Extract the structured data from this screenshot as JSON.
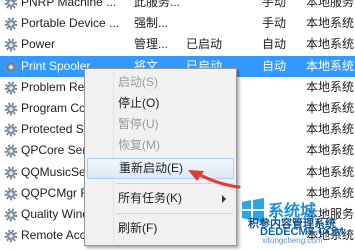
{
  "services": [
    {
      "name": "PNRP Machine ...",
      "desc": "此服务...",
      "status": "",
      "startup": "手动",
      "logon": "本地服务"
    },
    {
      "name": "Portable Device ...",
      "desc": "强制...",
      "status": "",
      "startup": "手动",
      "logon": "本地系统"
    },
    {
      "name": "Power",
      "desc": "管理...",
      "status": "已启动",
      "startup": "自动",
      "logon": "本地系统"
    },
    {
      "name": "Print Spooler",
      "desc": "将文...",
      "status": "已启动",
      "startup": "自动",
      "logon": "本地系统",
      "selected": true
    },
    {
      "name": "Problem Reports and Solutions Control Panel Support",
      "desc": "",
      "status": "",
      "startup": "",
      "logon": "本地系统"
    },
    {
      "name": "Program Compatibility Assistant Service",
      "desc": "",
      "status": "",
      "startup": "",
      "logon": "本地系统"
    },
    {
      "name": "Protected Storage",
      "desc": "",
      "status": "",
      "startup": "",
      "logon": "本地系统"
    },
    {
      "name": "QPCore Service",
      "desc": "",
      "status": "",
      "startup": "",
      "logon": "本地系统"
    },
    {
      "name": "QQMusicService",
      "desc": "",
      "status": "",
      "startup": "",
      "logon": "本地系统"
    },
    {
      "name": "QQPCMgr RTP Service",
      "desc": "",
      "status": "",
      "startup": "",
      "logon": "本地系统"
    },
    {
      "name": "Quality Windows Audio Video Experience",
      "desc": "",
      "status": "",
      "startup": "",
      "logon": "本地服务"
    },
    {
      "name": "Remote Access Auto Connection Manager",
      "desc": "",
      "status": "",
      "startup": "",
      "logon": "本地系统"
    }
  ],
  "context_menu": {
    "start": "启动(S)",
    "stop": "停止(O)",
    "pause": "暂停(U)",
    "resume": "恢复(M)",
    "restart": "重新启动(E)",
    "all_tasks": "所有任务(K)",
    "refresh": "刷新(F)"
  },
  "watermark": {
    "logo_text": "系统城",
    "site_text": "积参内容管理系统",
    "domain": "DEDECMS.COM",
    "small_domain": "xitongcheng.com"
  },
  "colors": {
    "selection": "#3399ff",
    "arrow": "#e53a2c",
    "watermark": "#0f63a8"
  },
  "icons": {
    "service": "gear-icon",
    "submenu": "chevron-right-icon"
  }
}
